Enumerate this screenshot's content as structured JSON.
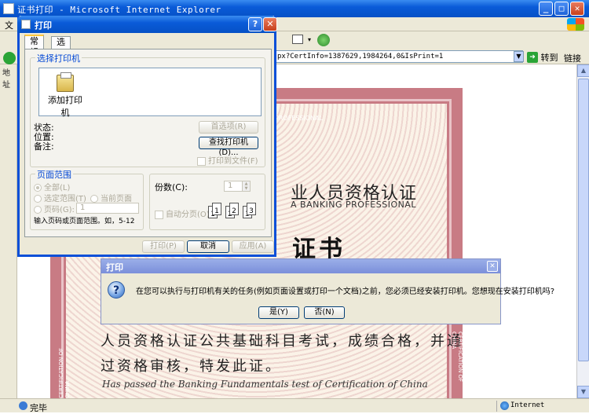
{
  "window": {
    "title": "证书打印 - Microsoft Internet Explorer",
    "minimize": "_",
    "maximize": "□",
    "close": "✕"
  },
  "menubar": {
    "first_item": "文"
  },
  "address": {
    "label": "地址",
    "url_visible": "px?CertInfo=1387629,1984264,0&IsPrint=1",
    "go_label": "转到",
    "links_label": "链接"
  },
  "statusbar": {
    "status": "完毕",
    "zone": "Internet"
  },
  "certificate": {
    "top_banner": "PROFESSIONAL",
    "heading_partial": "业人员资格认证",
    "subheading_partial": "A BANKING PROFESSIONAL",
    "big_title_partial": "证书",
    "body_line1": "人员资格认证公共基础科目考试，成绩合格，并通",
    "body_line2": "过资格审核，特发此证。",
    "english_line": "Has passed the Banking Fundamentals test of Certification of China",
    "side_left": "CERTIFICATION OF CHINA",
    "side_right": "CERTIFICATION OF CHINA"
  },
  "print_dialog": {
    "title": "打印",
    "help": "?",
    "close": "✕",
    "tabs": [
      "常规",
      "选项"
    ],
    "printer_group_label": "选择打印机",
    "add_printer_label": "添加打印机",
    "status_label": "状态:",
    "location_label": "位置:",
    "comment_label": "备注:",
    "preferences_button": "首选项(R)",
    "find_printer_button": "查找打印机(D)...",
    "print_to_file_label": "打印到文件(F)",
    "page_range_label": "页面范围",
    "all_label": "全部(L)",
    "selection_label": "选定范围(T)",
    "current_page_label": "当前页面(U)",
    "pages_label": "页码(G):",
    "pages_value": "1",
    "pages_hint": "输入页码或页面范围。如，5-12",
    "copies_label": "份数(C):",
    "copies_value": "1",
    "collate_label": "自动分页(O)",
    "print_button": "打印(P)",
    "cancel_button": "取消",
    "apply_button": "应用(A)",
    "collate_pages": [
      "1",
      "1",
      "2",
      "2",
      "3",
      "3"
    ]
  },
  "confirm_dialog": {
    "title": "打印",
    "close": "✕",
    "icon": "?",
    "message": "在您可以执行与打印机有关的任务(例如页面设置或打印一个文档)之前，您必须已经安装打印机。您想现在安装打印机吗?",
    "yes_button": "是(Y)",
    "no_button": "否(N)"
  },
  "colors": {
    "xp_blue": "#0a5bd8",
    "dialog_bg": "#ece9d8",
    "cert_border": "#c87b84",
    "legend_blue": "#0046d5"
  }
}
